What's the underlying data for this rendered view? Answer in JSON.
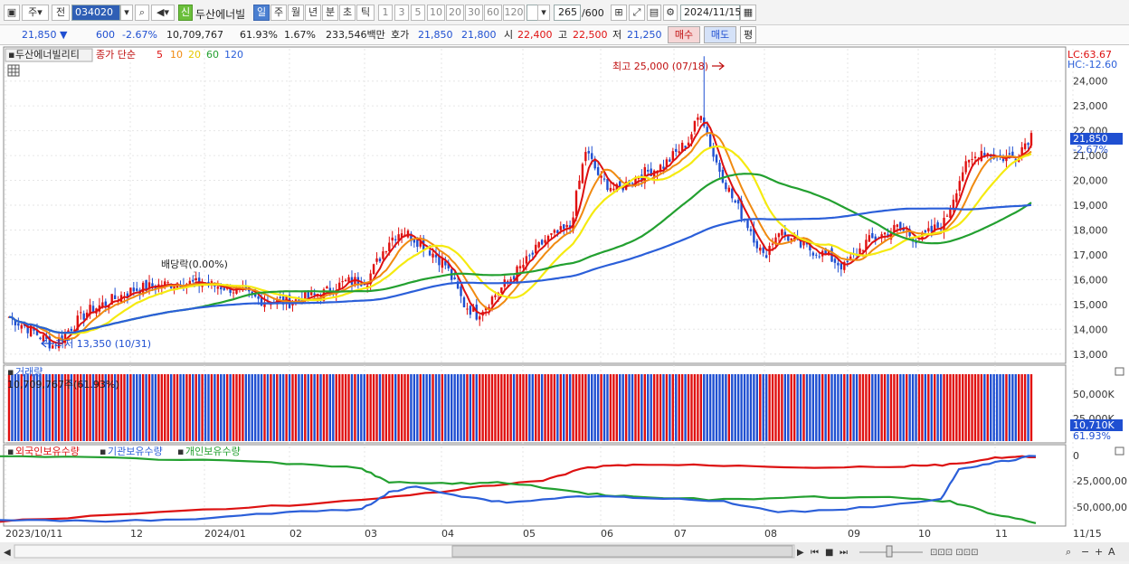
{
  "toolbar": {
    "type_select": "주",
    "mode_select": "전",
    "code": "034020",
    "badge_new": "신",
    "stock_name": "두산에너빌",
    "periods": [
      "일",
      "주",
      "월",
      "년",
      "분",
      "초",
      "틱"
    ],
    "active_period": "일",
    "intervals": [
      "1",
      "3",
      "5",
      "10",
      "20",
      "30",
      "60",
      "120"
    ],
    "count_shown": "265",
    "count_total": "/600",
    "date": "2024/11/15"
  },
  "quote": {
    "price": "21,850",
    "change": "600",
    "change_pct": "-2.67%",
    "volume": "10,709,767",
    "vol_ratio": "61.93%",
    "turnover": "1.67%",
    "amount": "233,546백만",
    "hoga_label": "호가",
    "ask": "21,850",
    "bid": "21,800",
    "open_label": "시",
    "open": "22,400",
    "high_label": "고",
    "high": "22,500",
    "low_label": "저",
    "low": "21,250",
    "buy_label": "매수",
    "sell_label": "매도",
    "eval_label": "평"
  },
  "price_panel": {
    "legend_name": "두산에너빌리티",
    "legend_ma": "종가 단순",
    "ma_periods": [
      "5",
      "10",
      "20",
      "60",
      "120"
    ],
    "ma_colors": [
      "#dd1111",
      "#f08a10",
      "#f5ea10",
      "#23a030",
      "#2b5fd9"
    ],
    "lc": "LC:63.67",
    "hc": "HC:-12.60",
    "current_price": "21,850",
    "current_pct": "-2.67%",
    "high_annotation": "최고 25,000 (07/18)",
    "low_annotation": "최저 13,350 (10/31)",
    "dividend_annotation": "배당락(0.00%)",
    "y_ticks": [
      "24,000",
      "23,000",
      "22,000",
      "21,000",
      "20,000",
      "19,000",
      "18,000",
      "17,000",
      "16,000",
      "15,000",
      "14,000",
      "13,000"
    ]
  },
  "volume_panel": {
    "title": "거래량",
    "value": "10,709,767주(61.93%)",
    "y_ticks": [
      "50,000K",
      "25,000K"
    ],
    "current": "10,710K",
    "current_pct": "61.93%"
  },
  "holding_panel": {
    "legend": [
      "외국인보유수량",
      "기관보유수량",
      "개인보유수량"
    ],
    "legend_colors": [
      "#dd1111",
      "#2b5fd9",
      "#23a030"
    ],
    "y_ticks": [
      "0",
      "-25,000,00",
      "-50,000,00"
    ]
  },
  "x_axis": {
    "labels": [
      "2023/10/11",
      "12",
      "2024/01",
      "02",
      "03",
      "04",
      "05",
      "06",
      "07",
      "08",
      "09",
      "10",
      "11",
      "11/15"
    ]
  },
  "colors": {
    "up": "#e01010",
    "down": "#1f4fd1",
    "accent": "#4a7fd1"
  },
  "chart_data": {
    "type": "candlestick",
    "x_range": [
      "2023/10/11",
      "2024/11/15"
    ],
    "ylim": [
      12700,
      25300
    ],
    "key_points": [
      {
        "date": "10/31",
        "low": 13350
      },
      {
        "date": "07/18",
        "high": 25000
      },
      {
        "date": "11/15",
        "close": 21850
      }
    ]
  }
}
